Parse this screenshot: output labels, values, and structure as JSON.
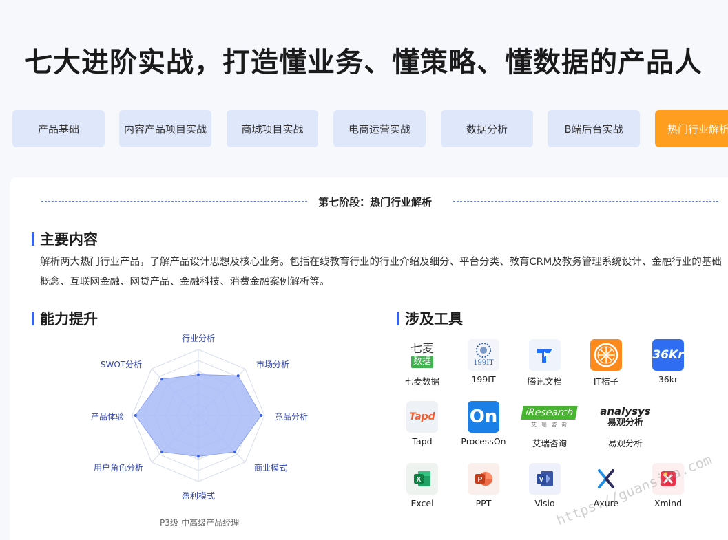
{
  "headline": "七大进阶实战，打造懂业务、懂策略、懂数据的产品人",
  "tabs": [
    {
      "label": "产品基础",
      "active": false
    },
    {
      "label": "内容产品项目实战",
      "active": false
    },
    {
      "label": "商城项目实战",
      "active": false
    },
    {
      "label": "电商运营实战",
      "active": false
    },
    {
      "label": "数据分析",
      "active": false
    },
    {
      "label": "B端后台实战",
      "active": false
    },
    {
      "label": "热门行业解析",
      "active": true
    }
  ],
  "stage_title": "第七阶段：热门行业解析",
  "main_content": {
    "heading": "主要内容",
    "text": "解析两大热门行业产品，了解产品设计思想及核心业务。包括在线教育行业的行业介绍及细分、平台分类、教育CRM及教务管理系统设计、金融行业的基础概念、互联网金融、网贷产品、金融科技、消费金融案例解析等。"
  },
  "ability": {
    "heading": "能力提升",
    "axes": [
      "行业分析",
      "市场分析",
      "竞品分析",
      "商业模式",
      "盈利模式",
      "用户角色分析",
      "产品体验",
      "SWOT分析"
    ],
    "values": [
      0.62,
      0.85,
      0.95,
      0.78,
      0.62,
      0.78,
      0.95,
      0.78
    ],
    "caption": "P3级-中高级产品经理"
  },
  "tools": {
    "heading": "涉及工具",
    "items": [
      {
        "name": "七麦数据",
        "icon": "qimai-logo-icon",
        "logo_top": "七麦",
        "logo_bottom": "数据"
      },
      {
        "name": "199IT",
        "icon": "199it-logo-icon",
        "logo_text": "199IT"
      },
      {
        "name": "腾讯文档",
        "icon": "tencent-docs-icon"
      },
      {
        "name": "IT桔子",
        "icon": "itjuzi-orange-icon"
      },
      {
        "name": "36kr",
        "icon": "36kr-logo-icon",
        "logo_text": "36Kr"
      },
      {
        "name": "Tapd",
        "icon": "tapd-logo-icon",
        "logo_text": "Tapd"
      },
      {
        "name": "ProcessOn",
        "icon": "processon-logo-icon",
        "logo_text": "On"
      },
      {
        "name": "艾瑞咨询",
        "icon": "iresearch-logo-icon",
        "logo_text": "iResearch",
        "logo_sub": "艾 瑞 咨 询"
      },
      {
        "name": "易观分析",
        "icon": "analysys-logo-icon",
        "logo_text": "analysys",
        "logo_sub": "易观分析"
      },
      {
        "name": "Excel",
        "icon": "excel-icon"
      },
      {
        "name": "PPT",
        "icon": "powerpoint-icon"
      },
      {
        "name": "Visio",
        "icon": "visio-icon"
      },
      {
        "name": "Axure",
        "icon": "axure-icon"
      },
      {
        "name": "Xmind",
        "icon": "xmind-icon"
      }
    ]
  },
  "watermark": "https://guansiwa.com",
  "colors": {
    "accent": "#3b63e5",
    "active_tab": "#ff9e1f",
    "tab_bg": "#dfe7fb",
    "radar_fill": "#a9bbf7"
  }
}
